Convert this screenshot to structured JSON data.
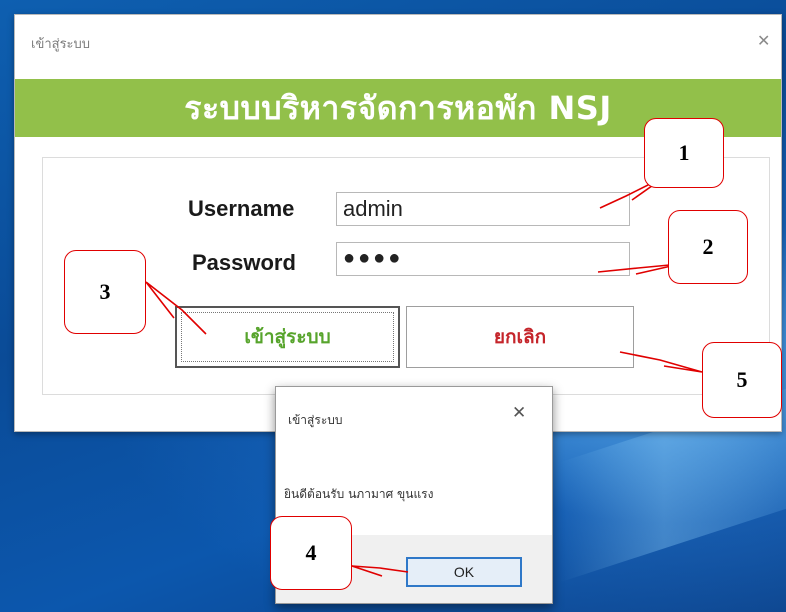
{
  "window": {
    "title": "เข้าสู่ระบบ",
    "close_glyph": "✕",
    "banner": "ระบบบริหารจัดการหอพัก NSJ"
  },
  "form": {
    "username_label": "Username",
    "username_value": "admin",
    "password_label": "Password",
    "password_value": "●●●●"
  },
  "buttons": {
    "login": "เข้าสู่ระบบ",
    "cancel": "ยกเลิก"
  },
  "dialog": {
    "title": "เข้าสู่ระบบ",
    "close_glyph": "✕",
    "message": "ยินดีต้อนรับ นภามาศ ขุนแรง",
    "ok": "OK"
  },
  "callouts": [
    "1",
    "2",
    "3",
    "4",
    "5"
  ],
  "colors": {
    "banner": "#92c04a",
    "login_text": "#57a42c",
    "cancel_text": "#c5252b",
    "callout_border": "#e00000"
  }
}
